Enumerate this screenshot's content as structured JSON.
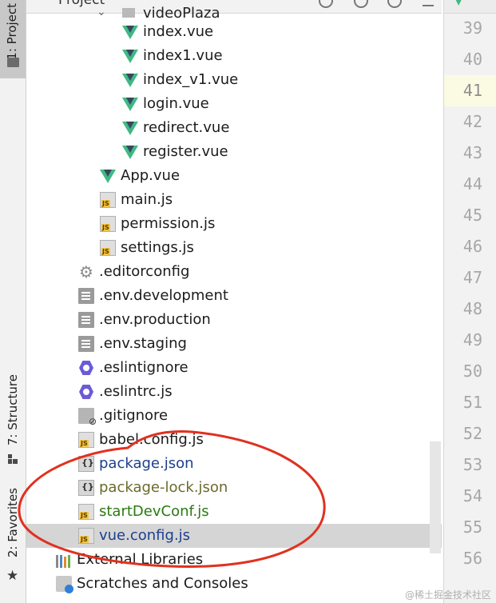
{
  "tool_strip": {
    "project_label": "1: Project",
    "structure_label": "7: Structure",
    "favorites_label": "2: Favorites"
  },
  "header": {
    "project_label": "Project",
    "clipped_folder": "videoPlaza"
  },
  "tree": {
    "rows": [
      {
        "name": "index.vue",
        "icon": "vue-icon",
        "color": "#1b1b1b"
      },
      {
        "name": "index1.vue",
        "icon": "vue-icon",
        "color": "#1b1b1b"
      },
      {
        "name": "index_v1.vue",
        "icon": "vue-icon",
        "color": "#1b1b1b"
      },
      {
        "name": "login.vue",
        "icon": "vue-icon",
        "color": "#1b1b1b"
      },
      {
        "name": "redirect.vue",
        "icon": "vue-icon",
        "color": "#1b1b1b"
      },
      {
        "name": "register.vue",
        "icon": "vue-icon",
        "color": "#1b1b1b"
      },
      {
        "name": "App.vue",
        "icon": "vue-icon",
        "color": "#1b1b1b"
      },
      {
        "name": "main.js",
        "icon": "js-file-icon",
        "color": "#1b1b1b"
      },
      {
        "name": "permission.js",
        "icon": "js-file-icon",
        "color": "#1b1b1b"
      },
      {
        "name": "settings.js",
        "icon": "js-file-icon",
        "color": "#1b1b1b"
      },
      {
        "name": ".editorconfig",
        "icon": "gear-icon",
        "color": "#1b1b1b"
      },
      {
        "name": ".env.development",
        "icon": "text-file-icon",
        "color": "#1b1b1b"
      },
      {
        "name": ".env.production",
        "icon": "text-file-icon",
        "color": "#1b1b1b"
      },
      {
        "name": ".env.staging",
        "icon": "text-file-icon",
        "color": "#1b1b1b"
      },
      {
        "name": ".eslintignore",
        "icon": "eslint-icon",
        "color": "#1b1b1b"
      },
      {
        "name": ".eslintrc.js",
        "icon": "eslint-icon",
        "color": "#1b1b1b"
      },
      {
        "name": ".gitignore",
        "icon": "gitignore-icon",
        "color": "#1b1b1b"
      },
      {
        "name": "babel.config.js",
        "icon": "js-file-icon",
        "color": "#1b1b1b"
      },
      {
        "name": "package.json",
        "icon": "json-file-icon",
        "color": "#1d3f8f"
      },
      {
        "name": "package-lock.json",
        "icon": "json-file-icon",
        "color": "#6b6a2b"
      },
      {
        "name": "startDevConf.js",
        "icon": "js-file-icon",
        "color": "#2a7a12"
      },
      {
        "name": "vue.config.js",
        "icon": "js-file-icon",
        "color": "#1d3f8f"
      },
      {
        "name": "External Libraries",
        "icon": "library-icon",
        "color": "#1b1b1b"
      },
      {
        "name": "Scratches and Consoles",
        "icon": "scratch-icon",
        "color": "#1b1b1b"
      }
    ]
  },
  "gutter": {
    "line_numbers": [
      "39",
      "40",
      "41",
      "42",
      "43",
      "44",
      "45",
      "46",
      "47",
      "48",
      "49",
      "50",
      "51",
      "52",
      "53",
      "54",
      "55",
      "56"
    ],
    "current_line": "41"
  },
  "watermark": "@稀土掘金技术社区"
}
